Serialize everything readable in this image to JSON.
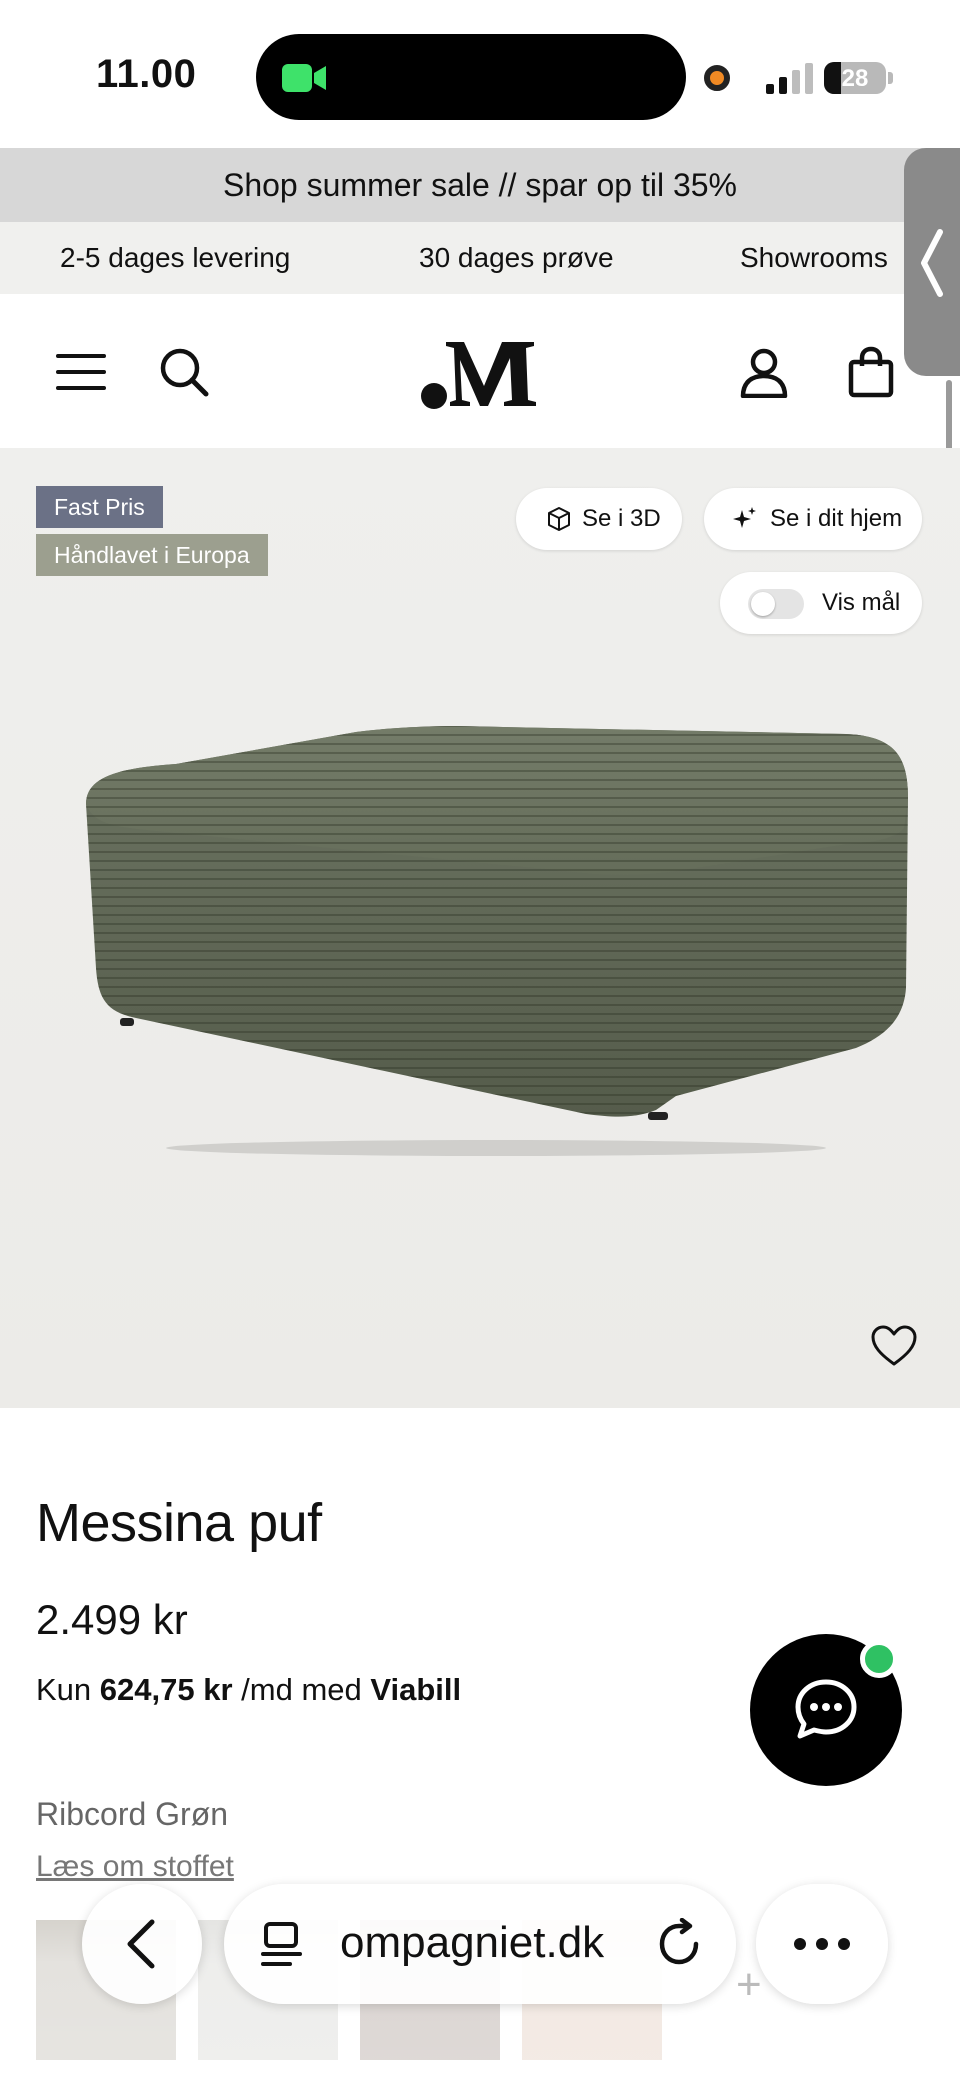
{
  "status_bar": {
    "time": "11.00",
    "battery": "28",
    "battery_level": 0.28
  },
  "promo": {
    "text": "Shop summer sale // spar op til 35%"
  },
  "usp": {
    "items": [
      "2-5 dages levering",
      "30 dages prøve",
      "Showrooms"
    ]
  },
  "header": {
    "icons": [
      "menu-icon",
      "search-icon",
      "account-icon",
      "bag-icon"
    ],
    "logo": ".M"
  },
  "product_image": {
    "badges": [
      "Fast Pris",
      "Håndlavet i Europa"
    ],
    "buttons": {
      "view_3d": "Se i 3D",
      "view_home": "Se i dit hjem",
      "show_dimensions": "Vis mål"
    },
    "show_dimensions_on": false,
    "fabric_color": "#6c7462"
  },
  "product": {
    "title": "Messina puf",
    "price": "2.499 kr",
    "viabill": {
      "prefix": "Kun",
      "amount": "624,75 kr",
      "mid": "/md med",
      "provider": "Viabill"
    },
    "color_name": "Ribcord Grøn",
    "fabric_link": "Læs om stoffet",
    "swatch_colors": [
      "#c9c5bd",
      "#dcdcd9",
      "#b7aca6",
      "#e6d3c6"
    ],
    "add_more": "+"
  },
  "browser": {
    "url": "ompagniet.dk"
  },
  "colors": {
    "promo_bg": "#d7d7d7",
    "usp_bg": "#f0f0ee",
    "badge_fast": "#6b7186",
    "badge_europe": "#9c9f8f",
    "chat_online": "#2fc163"
  }
}
